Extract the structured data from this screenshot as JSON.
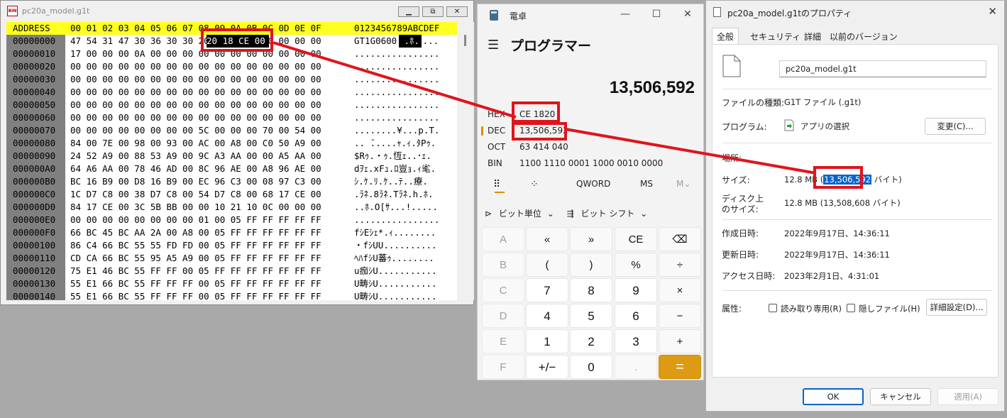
{
  "hex": {
    "title": "pc20a_model.g1t",
    "app_icon_text": "BIN",
    "header": {
      "address": "ADDRESS",
      "bytes": "00 01 02 03 04 05 06 07 08 09 0A 0B 0C 0D 0E 0F",
      "text": "0123456789ABCDEF"
    },
    "rows": [
      {
        "addr": "00000000",
        "bytes": "47 54 31 47 30 36 30 30 20 18 CE 00 00 00 00 00",
        "text": "GT1G0600 .ﾎ....."
      },
      {
        "addr": "00000010",
        "bytes": "17 00 00 00 0A 00 00 00 00 00 00 00 00 00 00 00",
        "text": "................"
      },
      {
        "addr": "00000020",
        "bytes": "00 00 00 00 00 00 00 00 00 00 00 00 00 00 00 00",
        "text": "................"
      },
      {
        "addr": "00000030",
        "bytes": "00 00 00 00 00 00 00 00 00 00 00 00 00 00 00 00",
        "text": "................"
      },
      {
        "addr": "00000040",
        "bytes": "00 00 00 00 00 00 00 00 00 00 00 00 00 00 00 00",
        "text": "................"
      },
      {
        "addr": "00000050",
        "bytes": "00 00 00 00 00 00 00 00 00 00 00 00 00 00 00 00",
        "text": "................"
      },
      {
        "addr": "00000060",
        "bytes": "00 00 00 00 00 00 00 00 00 00 00 00 00 00 00 00",
        "text": "................"
      },
      {
        "addr": "00000070",
        "bytes": "00 00 00 00 00 00 00 00 5C 00 00 00 70 00 54 00",
        "text": "........¥...p.T."
      },
      {
        "addr": "00000080",
        "bytes": "84 00 7E 00 98 00 93 00 AC 00 A8 00 C0 50 A9 00",
        "text": ".. ̄.....ｬ.ｨ.ﾀPｩ."
      },
      {
        "addr": "00000090",
        "bytes": "24 52 A9 00 88 53 A9 00 9C A3 AA 00 00 A5 AA 00",
        "text": "$Rｩ.・ｩ.恆ｪ..･ｪ."
      },
      {
        "addr": "000000A0",
        "bytes": "64 A6 AA 00 78 46 AD 00 8C 96 AE 00 A8 96 AE 00",
        "text": "dｦｪ.xFｭ.ﾛ豈ｮ.ｨ毟."
      },
      {
        "addr": "000000B0",
        "bytes": "BC 16 B9 00 D8 16 B9 00 EC 96 C3 00 08 97 C3 00",
        "text": "ｼ.ｹ.ﾘ.ｹ..ﾃ..療."
      },
      {
        "addr": "000000C0",
        "bytes": "1C D7 C8 00 38 D7 C8 00 54 D7 C8 00 68 17 CE 00",
        "text": ".ﾗﾈ.8ﾗﾈ.Tﾗﾈ.h.ﾎ."
      },
      {
        "addr": "000000D0",
        "bytes": "84 17 CE 00 3C 5B BB 00 00 10 21 10 0C 00 00 00",
        "text": "..ﾎ.O[ｻ...!....."
      },
      {
        "addr": "000000E0",
        "bytes": "00 00 00 00 00 00 00 00 01 00 05 FF FF FF FF FF",
        "text": "................"
      },
      {
        "addr": "000000F0",
        "bytes": "66 BC 45 BC AA 2A 00 A8 00 05 FF FF FF FF FF FF",
        "text": "fｼEｼｪ*.ｨ........"
      },
      {
        "addr": "00000100",
        "bytes": "86 C4 66 BC 55 55 FD FD 00 05 FF FF FF FF FF FF",
        "text": "・fｼUU.........."
      },
      {
        "addr": "00000110",
        "bytes": "CD CA 66 BC 55 95 A5 A9 00 05 FF FF FF FF FF FF",
        "text": "ﾍﾊfｼU蕃ｩ........"
      },
      {
        "addr": "00000120",
        "bytes": "75 E1 46 BC 55 FF FF 00 05 FF FF FF FF FF FF FF",
        "text": "u痂ｼU..........."
      },
      {
        "addr": "00000130",
        "bytes": "55 E1 66 BC 55 FF FF FF 00 05 FF FF FF FF FF FF",
        "text": "U畴ｼU..........."
      },
      {
        "addr": "00000140",
        "bytes": "55 E1 66 BC 55 FF FF FF 00 05 FF FF FF FF FF FF",
        "text": "U畴ｼU..........."
      }
    ],
    "selection_bytes": "20 18 CE 00",
    "selection_text": " .ﾎ."
  },
  "calc": {
    "title": "電卓",
    "mode": "プログラマー",
    "display": "13,506,592",
    "radix": [
      {
        "name": "HEX",
        "value": "CE 1820"
      },
      {
        "name": "DEC",
        "value": "13,506,592"
      },
      {
        "name": "OCT",
        "value": "63 414 040"
      },
      {
        "name": "BIN",
        "value": "1100 1110 0001 1000 0010 0000"
      }
    ],
    "word_size": "QWORD",
    "memory_store": "MS",
    "memory_menu": "M⌄",
    "bitwise": "ビット単位",
    "bitshift": "ビット シフト",
    "keys": [
      [
        "A",
        "«",
        "»",
        "CE",
        "⌫"
      ],
      [
        "B",
        "(",
        ")",
        "%",
        "÷"
      ],
      [
        "C",
        "7",
        "8",
        "9",
        "×"
      ],
      [
        "D",
        "4",
        "5",
        "6",
        "−"
      ],
      [
        "E",
        "1",
        "2",
        "3",
        "+"
      ],
      [
        "F",
        "+/−",
        "0",
        ".",
        "="
      ]
    ]
  },
  "props": {
    "title": "pc20a_model.g1tのプロパティ",
    "tabs": [
      "全般",
      "セキュリティ",
      "詳細",
      "以前のバージョン"
    ],
    "filename": "pc20a_model.g1t",
    "file_type_label": "ファイルの種類:",
    "file_type": "G1T ファイル (.g1t)",
    "program_label": "プログラム:",
    "program": "アプリの選択",
    "change_button": "変更(C)...",
    "location_label": "場所:",
    "size_label": "サイズ:",
    "size_prefix": "12.8 MB (",
    "size_bytes": "13,506,592",
    "size_suffix": " バイト)",
    "disk_size_label_1": "ディスク上",
    "disk_size_label_2": "のサイズ:",
    "disk_size": "12.8 MB (13,508,608 バイト)",
    "created_label": "作成日時:",
    "created": "2022年9月17日、14:36:11",
    "modified_label": "更新日時:",
    "modified": "2022年9月17日、14:36:11",
    "accessed_label": "アクセス日時:",
    "accessed": "2023年2月1日、4:31:01",
    "attr_label": "属性:",
    "readonly": "読み取り専用(R)",
    "hidden": "隠しファイル(H)",
    "advanced_button": "詳細設定(D)...",
    "ok": "OK",
    "cancel": "キャンセル",
    "apply": "適用(A)"
  }
}
